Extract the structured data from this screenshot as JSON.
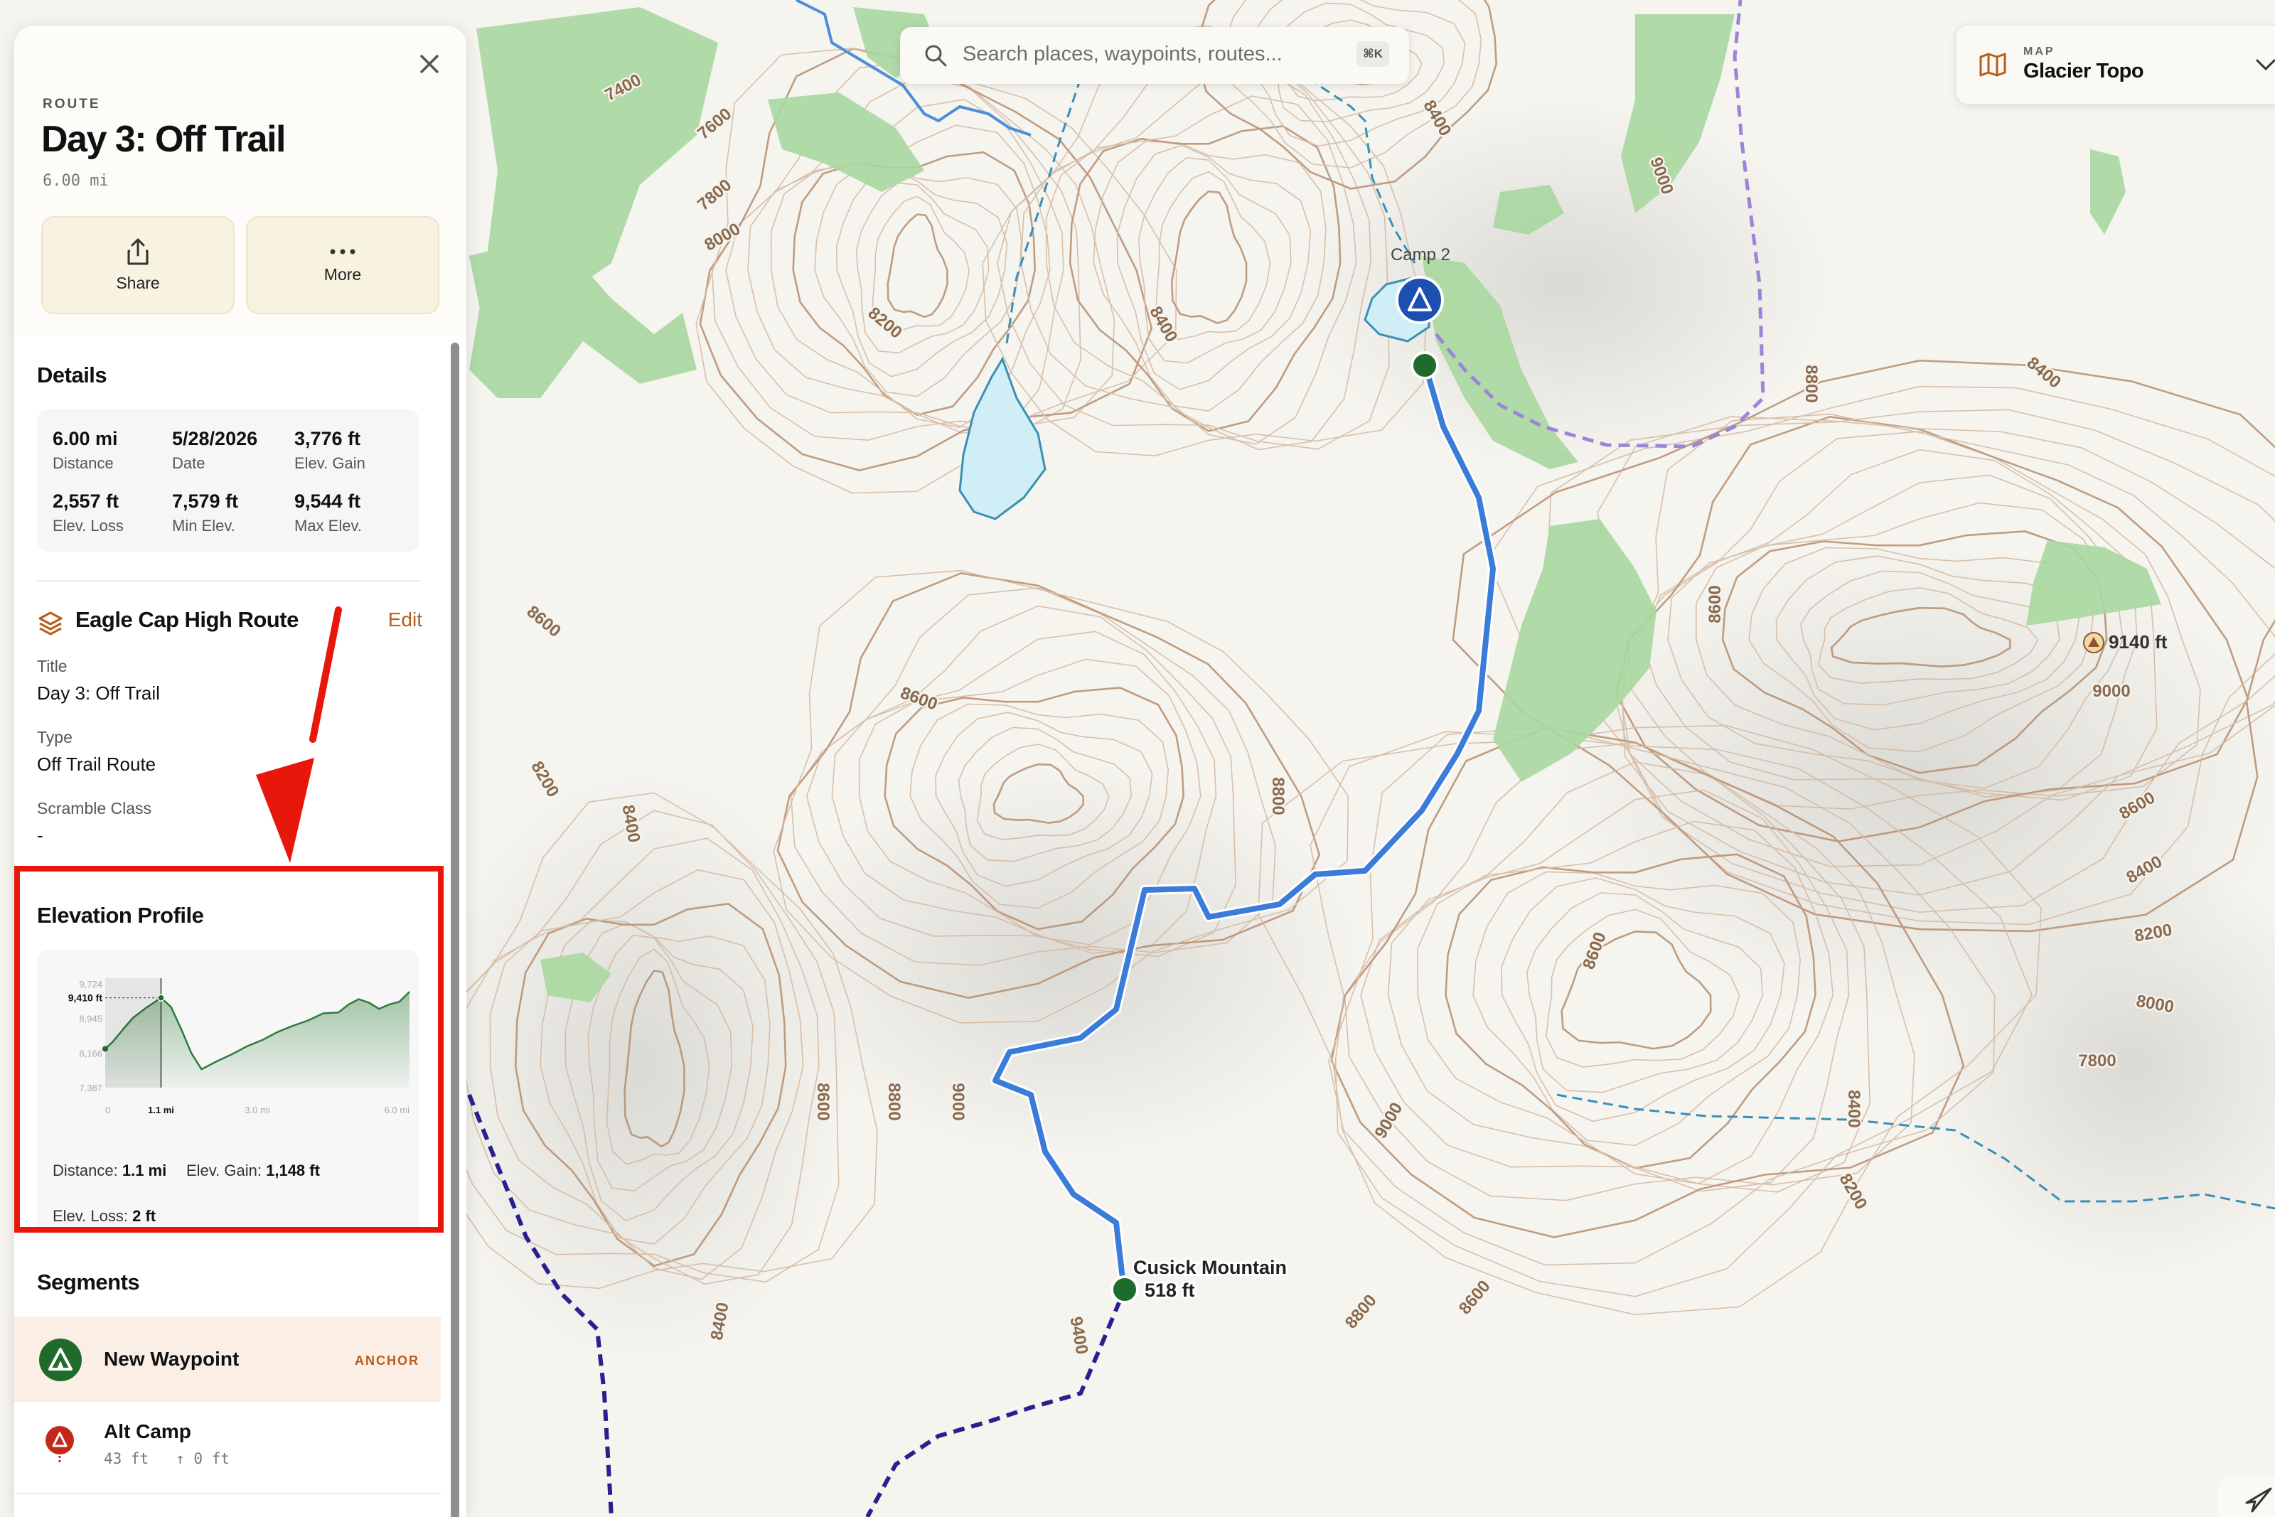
{
  "map": {
    "contour_labels": [
      "7400",
      "7600",
      "7800",
      "8000",
      "8200",
      "8400",
      "8600",
      "8800",
      "9000",
      "9400"
    ],
    "peak_label": "9140 ft",
    "camp_label": "Camp 2",
    "summit_label": "Cusick Mountain",
    "summit_elev": "518 ft",
    "colors": {
      "route": "#3b7bd9",
      "trail": "#2a1f8f",
      "alt_trail": "#9a86d8",
      "stream": "#3a8fb6",
      "forest": "#a8d8a0",
      "lake": "#cfeef5",
      "contour": "#b78d6d"
    }
  },
  "search": {
    "placeholder": "Search places, waypoints, routes...",
    "shortcut": "⌘K",
    "icon": "search-icon"
  },
  "layer": {
    "label": "MAP",
    "value": "Glacier Topo",
    "icon": "map-icon"
  },
  "panel": {
    "kicker": "ROUTE",
    "title": "Day 3: Off Trail",
    "length": "6.00 mi",
    "actions": [
      {
        "label": "Share",
        "icon": "share-icon"
      },
      {
        "label": "More",
        "icon": "ellipsis-icon"
      }
    ],
    "details": {
      "title": "Details",
      "stats": [
        {
          "value": "6.00 mi",
          "label": "Distance"
        },
        {
          "value": "5/28/2026",
          "label": "Date"
        },
        {
          "value": "3,776 ft",
          "label": "Elev. Gain"
        },
        {
          "value": "2,557 ft",
          "label": "Elev. Loss"
        },
        {
          "value": "7,579 ft",
          "label": "Min Elev."
        },
        {
          "value": "9,544 ft",
          "label": "Max Elev."
        }
      ]
    },
    "group": {
      "name": "Eagle Cap High Route",
      "edit": "Edit",
      "fields": [
        {
          "label": "Title",
          "value": "Day 3: Off Trail"
        },
        {
          "label": "Type",
          "value": "Off Trail Route"
        },
        {
          "label": "Scramble Class",
          "value": "-"
        }
      ]
    },
    "elevation": {
      "title": "Elevation Profile",
      "cursor_label": "9,410 ft",
      "cursor_x_label": "1.1 mi",
      "stats": [
        {
          "label": "Distance:",
          "value": "1.1 mi"
        },
        {
          "label": "Elev. Gain:",
          "value": "1,148 ft"
        },
        {
          "label": "Elev. Loss:",
          "value": "2 ft"
        }
      ]
    },
    "segments": {
      "title": "Segments",
      "items": [
        {
          "name": "New Waypoint",
          "badge": "ANCHOR",
          "icon": "tent-icon"
        },
        {
          "name": "Alt Camp",
          "sub": "43 ft   ↑ 0 ft",
          "icon": "tent-pin-icon"
        }
      ]
    }
  },
  "chart_data": {
    "type": "area",
    "x": [
      0,
      0.15,
      0.35,
      0.55,
      0.8,
      1.1,
      1.3,
      1.5,
      1.7,
      1.9,
      2.2,
      2.5,
      2.8,
      3.1,
      3.4,
      3.7,
      4.0,
      4.3,
      4.6,
      4.8,
      5.0,
      5.2,
      5.4,
      5.6,
      5.8,
      6.0
    ],
    "y": [
      8260,
      8420,
      8700,
      8960,
      9180,
      9410,
      9200,
      8700,
      8160,
      7800,
      7980,
      8140,
      8320,
      8460,
      8640,
      8780,
      8900,
      9060,
      9080,
      9260,
      9380,
      9300,
      9160,
      9260,
      9320,
      9544
    ],
    "xlim": [
      0,
      6.0
    ],
    "ylim": [
      7387,
      9724
    ],
    "y_ticks": [
      "9,724",
      "8,945",
      "8,166",
      "7,387"
    ],
    "x_ticks": [
      "0",
      "3.0 mi",
      "6.0 mi"
    ],
    "cursor_x": 1.1,
    "cursor_y": 9410
  }
}
